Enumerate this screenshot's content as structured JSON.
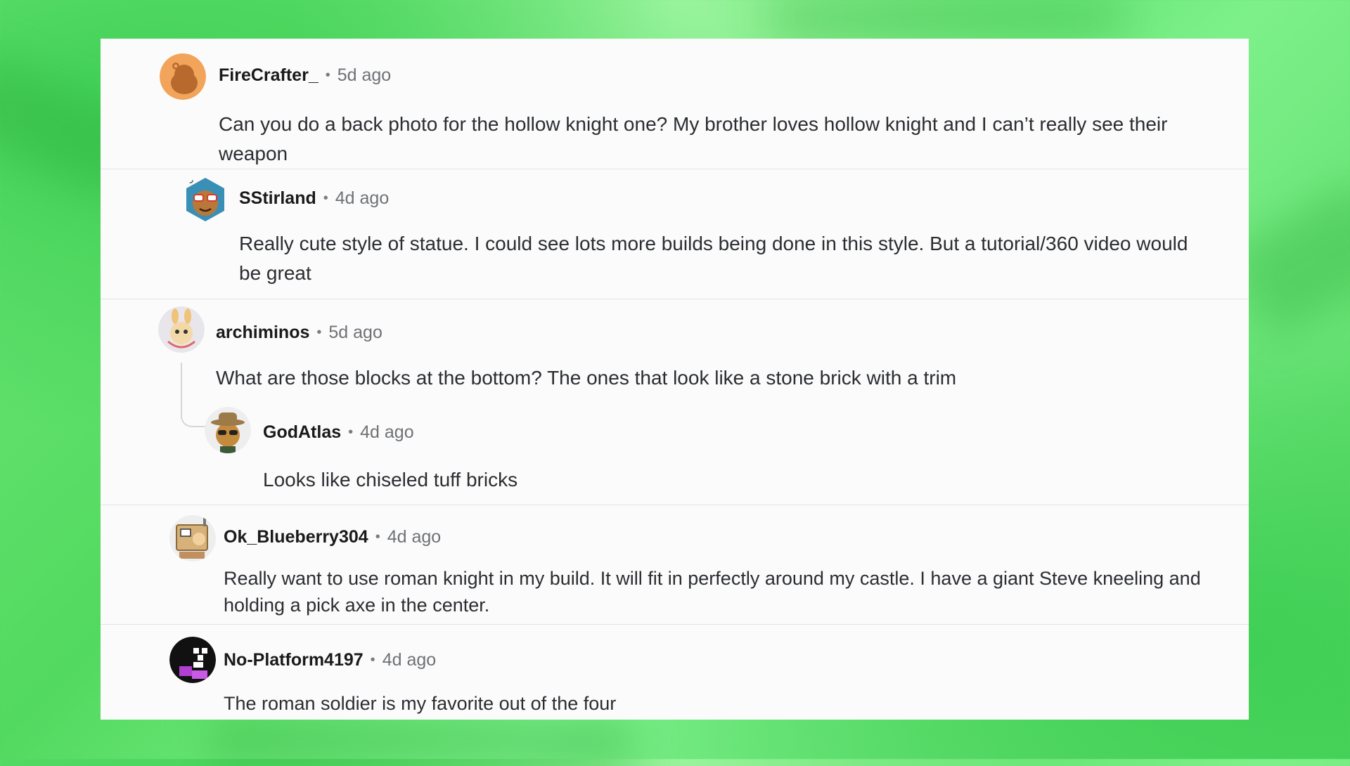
{
  "comments": [
    {
      "username": "FireCrafter_",
      "separator": "•",
      "time": "5d ago",
      "text": "Can you do a back photo for the hollow knight one? My brother loves hollow knight and I can’t really see their weapon",
      "avatar_icon": "reddit-snoo-default-avatar-icon",
      "avatar_color": "#f1a45a"
    },
    {
      "username": "SStirland",
      "separator": "•",
      "time": "4d ago",
      "text": "Really cute style of statue. I could see lots more builds being done in this style. But a tutorial/360 video would be great",
      "avatar_icon": "snoo-glasses-avatar-icon",
      "avatar_color": "#3a8fb7"
    },
    {
      "username": "archiminos",
      "separator": "•",
      "time": "5d ago",
      "text": "What are those blocks at the bottom? The ones that look like a stone brick with a trim",
      "avatar_icon": "snoo-bunny-avatar-icon",
      "avatar_color": "#e8e6ea"
    },
    {
      "username": "GodAtlas",
      "separator": "•",
      "time": "4d ago",
      "text": "Looks like chiseled tuff bricks",
      "avatar_icon": "snoo-cowboy-avatar-icon",
      "avatar_color": "#c58b3c"
    },
    {
      "username": "Ok_Blueberry304",
      "separator": "•",
      "time": "4d ago",
      "text": "Really want to use roman knight in my build. It will fit in perfectly around my castle. I have a giant Steve kneeling and holding a pick axe in the center.",
      "avatar_icon": "snoo-box-robot-avatar-icon",
      "avatar_color": "#d6b27a"
    },
    {
      "username": "No-Platform4197",
      "separator": "•",
      "time": "4d ago",
      "text": "The roman soldier is my favorite out of the four",
      "avatar_icon": "snoo-black-pixel-avatar-icon",
      "avatar_color": "#111111"
    }
  ]
}
